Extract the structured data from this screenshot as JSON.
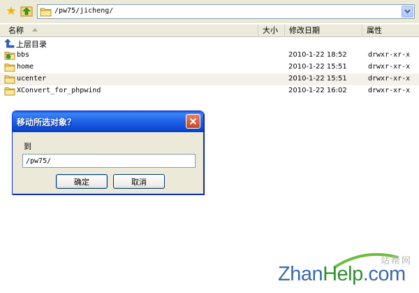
{
  "address": {
    "path": "/pw75/jicheng/"
  },
  "columns": {
    "name": "名称",
    "size": "大小",
    "date": "修改日期",
    "attr": "属性"
  },
  "parent_label": "上层目录",
  "files": [
    {
      "name": "bbs",
      "date": "2010-1-22 18:52",
      "attr": "drwxr-xr-x"
    },
    {
      "name": "home",
      "date": "2010-1-22 15:51",
      "attr": "drwxr-xr-x"
    },
    {
      "name": "ucenter",
      "date": "2010-1-22 15:51",
      "attr": "drwxr-xr-x"
    },
    {
      "name": "XConvert_for_phpwind",
      "date": "2010-1-22 16:02",
      "attr": "drwxr-xr-x"
    }
  ],
  "dialog": {
    "title": "移动所选对象？",
    "label": "到",
    "value": "/pw75/",
    "ok_label": "确定",
    "cancel_label": "取消"
  },
  "watermark": {
    "cn": "站帮网",
    "logo_a": "Zhan",
    "logo_b": "Help",
    "logo_c": ".com"
  },
  "colors": {
    "title_bar": "#0c49d3",
    "folder": "#f5d76e",
    "selected_row": "#f2f1ea"
  }
}
